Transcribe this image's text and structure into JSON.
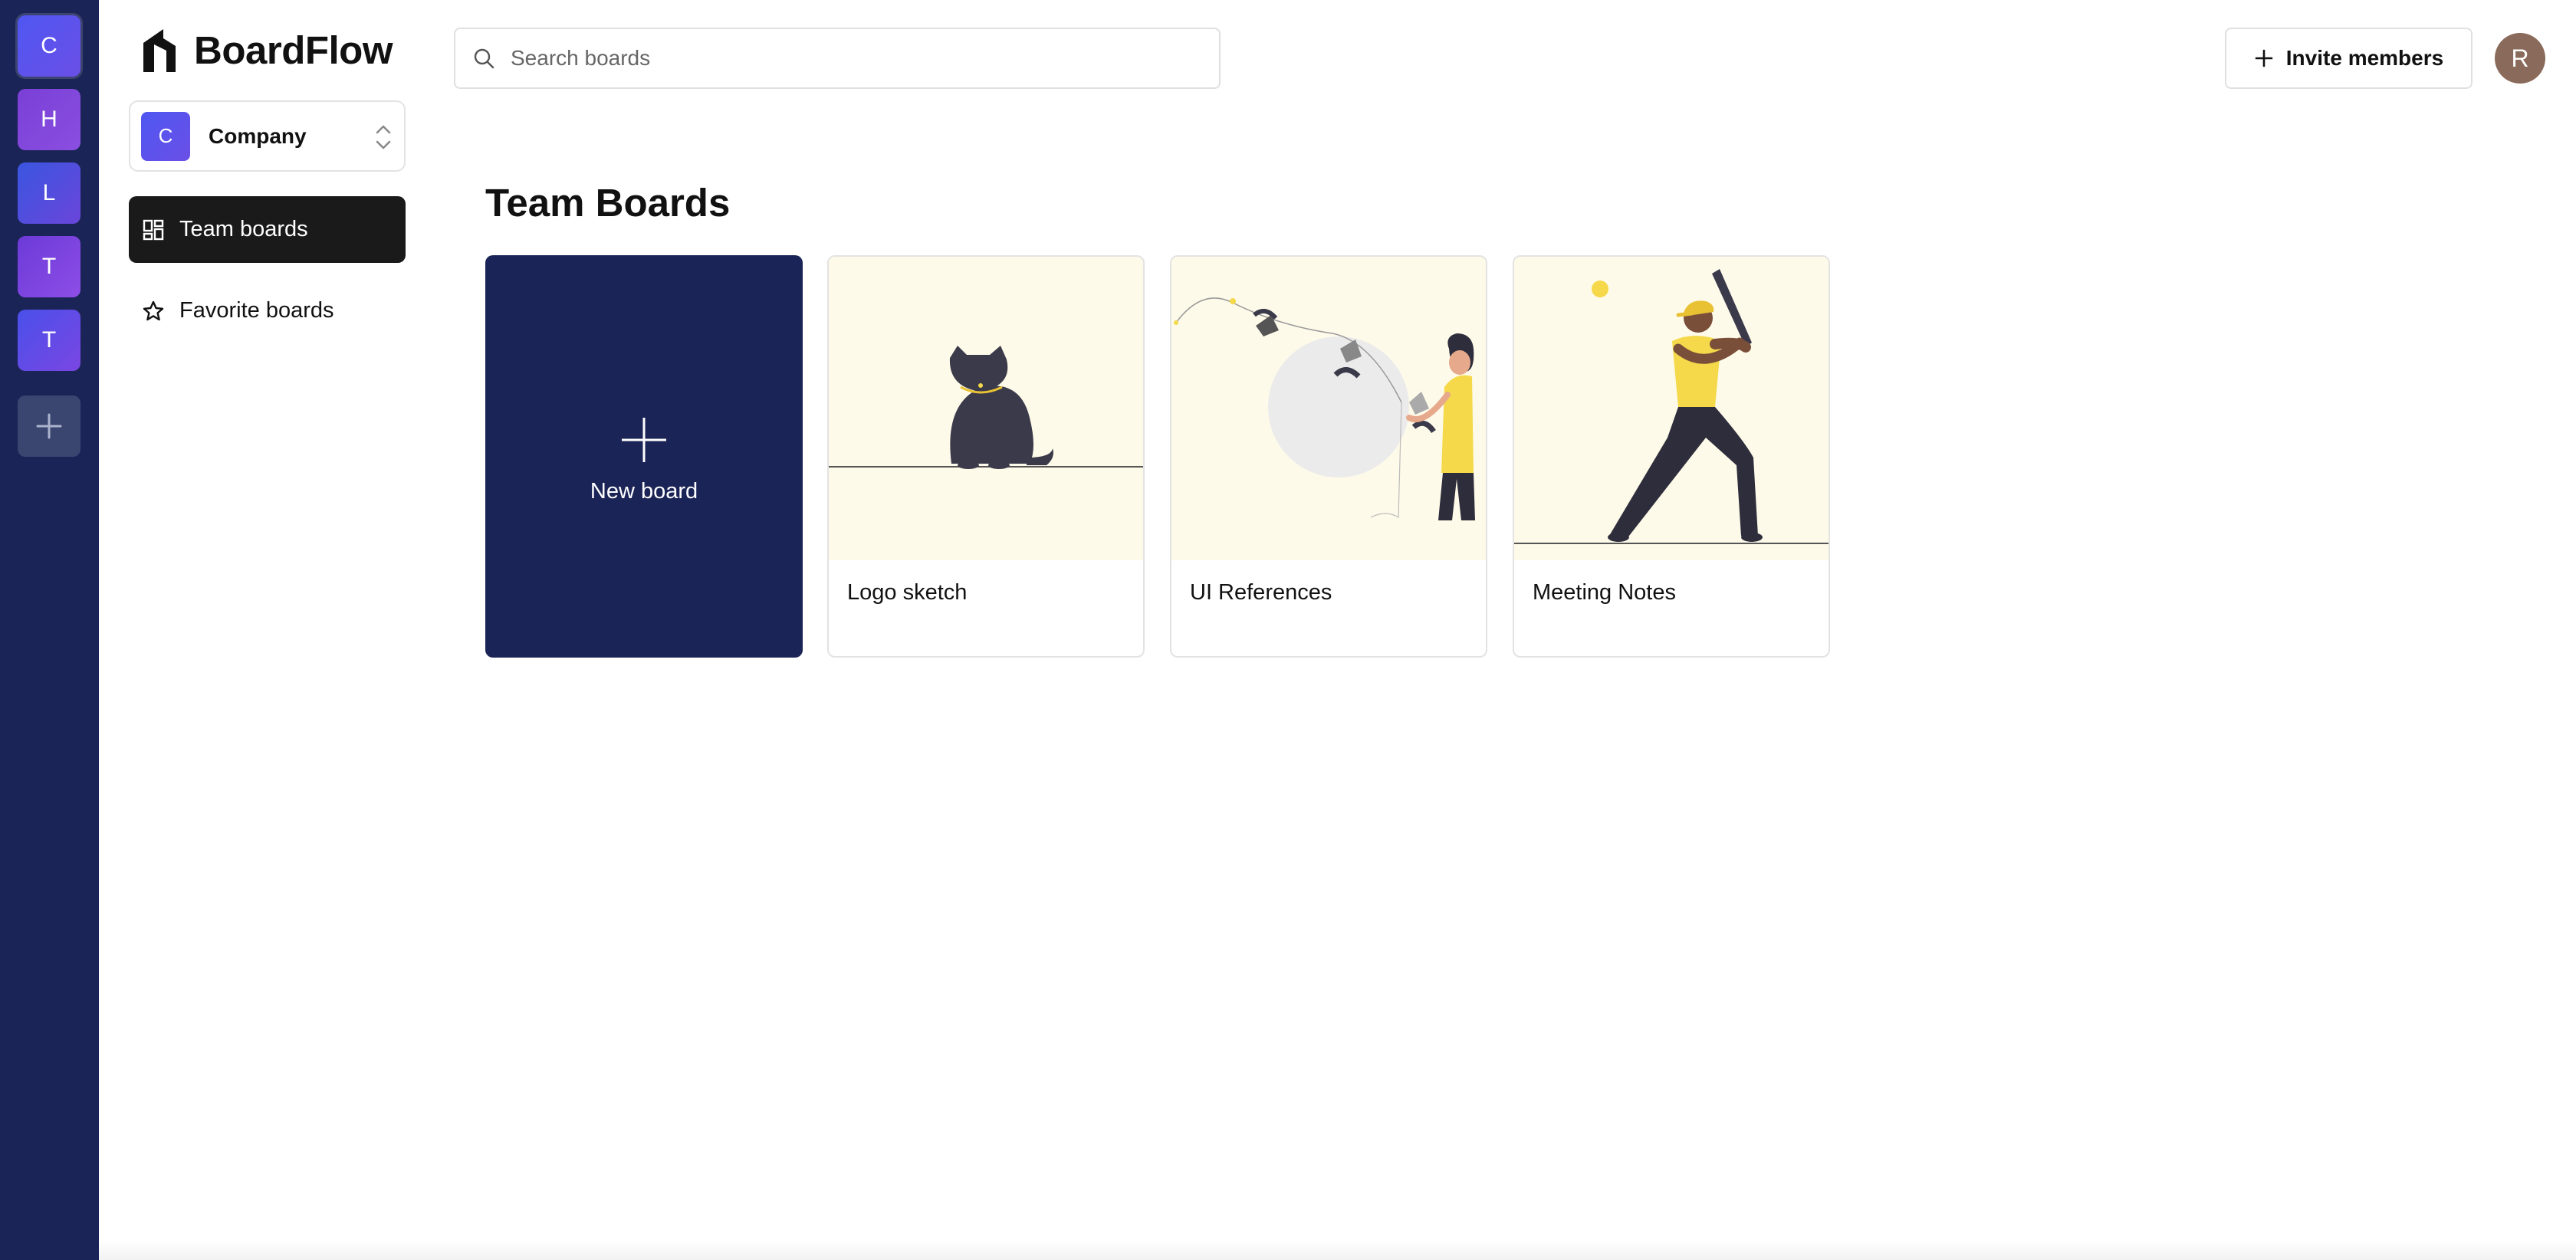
{
  "rail": {
    "orgs": [
      {
        "initial": "C"
      },
      {
        "initial": "H"
      },
      {
        "initial": "L"
      },
      {
        "initial": "T"
      },
      {
        "initial": "T"
      }
    ],
    "add_icon": "plus-icon"
  },
  "brand": {
    "name": "BoardFlow",
    "logo_icon": "boardflow-logo-icon"
  },
  "org_switcher": {
    "initial": "C",
    "name": "Company",
    "icon": "chevron-up-down-icon"
  },
  "nav": {
    "team_boards": {
      "label": "Team boards",
      "icon": "grid-icon",
      "active": true
    },
    "favorite_boards": {
      "label": "Favorite boards",
      "icon": "star-icon"
    }
  },
  "search": {
    "placeholder": "Search boards",
    "value": "",
    "icon": "search-icon"
  },
  "invite": {
    "label": "Invite members",
    "icon": "plus-icon"
  },
  "user": {
    "initial": "R"
  },
  "main": {
    "title": "Team Boards",
    "new_board_label": "New board",
    "boards": [
      {
        "name": "Logo sketch",
        "illustration": "cat-illustration"
      },
      {
        "name": "UI References",
        "illustration": "fishing-illustration"
      },
      {
        "name": "Meeting Notes",
        "illustration": "baseball-illustration"
      }
    ]
  },
  "colors": {
    "rail_bg": "#1b2456",
    "new_board_bg": "#1b2456",
    "active_nav_bg": "#1a1a1a",
    "thumb_bg": "#fefae9",
    "accent_yellow": "#f5d94a"
  }
}
